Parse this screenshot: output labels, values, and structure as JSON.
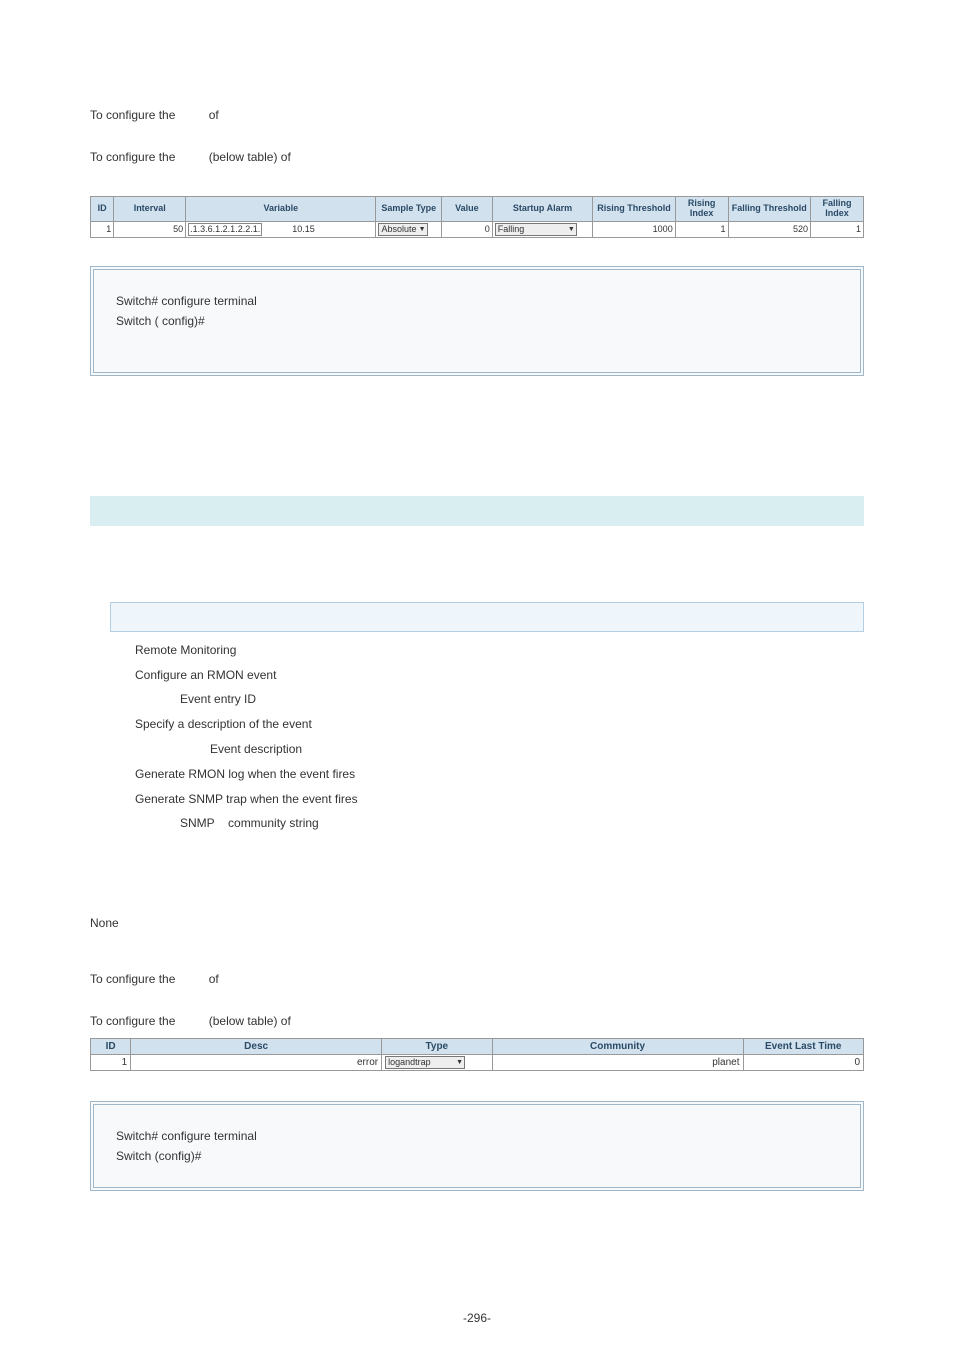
{
  "top": {
    "cfg1": "To configure the",
    "cfg1b": "of",
    "cfg2": "To configure the",
    "cfg2b": "(below table) of"
  },
  "alarm_headers": {
    "id": "ID",
    "interval": "Interval",
    "variable": "Variable",
    "sample_type": "Sample Type",
    "value": "Value",
    "startup_alarm": "Startup Alarm",
    "rising_threshold": "Rising Threshold",
    "rising_index": "Rising Index",
    "falling_threshold": "Falling Threshold",
    "falling_index": "Falling Index"
  },
  "alarm_row": {
    "id": "1",
    "interval": "50",
    "variable_a": ".1.3.6.1.2.1.2.2.1.",
    "variable_b": "10.15",
    "sample_type": "Absolute",
    "value": "0",
    "startup": "Falling",
    "rising_thr": "1000",
    "rising_idx": "1",
    "falling_thr": "520",
    "falling_idx": "1"
  },
  "code1": {
    "l1": "Switch# configure terminal",
    "l2": "Switch ( config)#"
  },
  "defs": {
    "rmon": "Remote Monitoring",
    "configure": "Configure an RMON event",
    "entryid": "Event entry ID",
    "specify": "Specify a description of the event",
    "eventdesc": "Event description",
    "genlog": "Generate RMON log when the event fires",
    "gentrap": "Generate SNMP trap when the event fires",
    "snmp_a": "SNMP",
    "snmp_b": "community string"
  },
  "defaults": {
    "none": "None"
  },
  "bottom": {
    "cfg1": "To configure the",
    "cfg1b": "of",
    "cfg2": "To configure the",
    "cfg2b": "(below table) of"
  },
  "event_headers": {
    "id": "ID",
    "desc": "Desc",
    "type": "Type",
    "community": "Community",
    "eventlast": "Event Last Time"
  },
  "event_row": {
    "id": "1",
    "desc": "error",
    "type": "logandtrap",
    "community": "planet",
    "eventlast": "0"
  },
  "code2": {
    "l1": "Switch# configure terminal",
    "l2": "Switch (config)#"
  },
  "pagenum": "-296-"
}
